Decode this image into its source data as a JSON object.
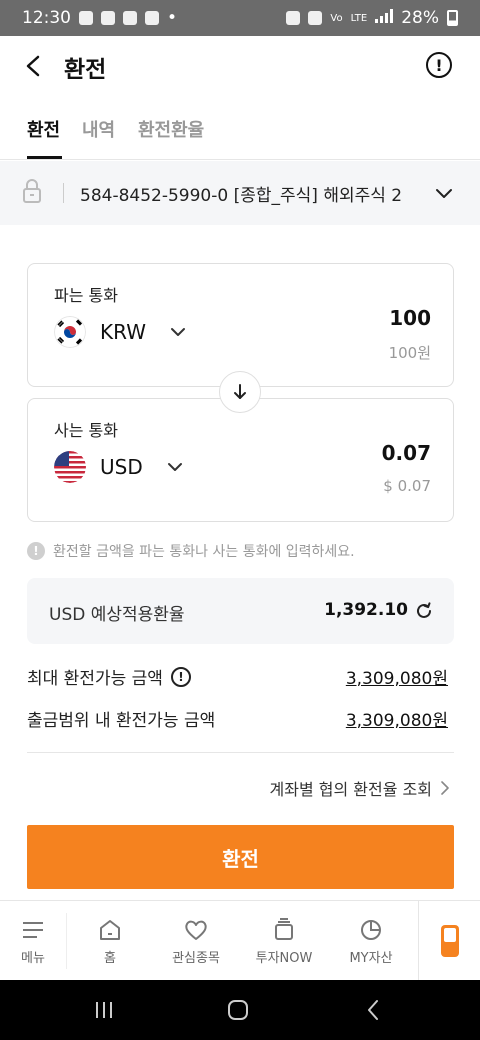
{
  "status_bar": {
    "time": "12:30",
    "network": "LTE",
    "battery": "28%"
  },
  "header": {
    "title": "환전"
  },
  "tabs": [
    {
      "label": "환전",
      "active": true
    },
    {
      "label": "내역",
      "active": false
    },
    {
      "label": "환전환율",
      "active": false
    }
  ],
  "account": {
    "text": "584-8452-5990-0  [종합_주식] 해외주식 2"
  },
  "sell": {
    "label": "파는 통화",
    "currency": "KRW",
    "amount": "100",
    "amount_sub": "100원"
  },
  "buy": {
    "label": "사는 통화",
    "currency": "USD",
    "amount": "0.07",
    "amount_sub": "$ 0.07"
  },
  "hint": "환전할 금액을 파는 통화나 사는 통화에 입력하세요.",
  "rate": {
    "label": "USD 예상적용환율",
    "value": "1,392.10"
  },
  "limits": [
    {
      "label": "최대 환전가능 금액",
      "value": "3,309,080원"
    },
    {
      "label": "출금범위 내 환전가능 금액",
      "value": "3,309,080원"
    }
  ],
  "rate_link": "계좌별 협의 환전율 조회",
  "cta": "환전",
  "bottom_nav": [
    {
      "label": "메뉴",
      "icon": "menu-icon"
    },
    {
      "label": "홈",
      "icon": "home-icon"
    },
    {
      "label": "관심종목",
      "icon": "heart-icon"
    },
    {
      "label": "투자NOW",
      "icon": "layers-icon"
    },
    {
      "label": "MY자산",
      "icon": "pie-chart-icon"
    }
  ],
  "colors": {
    "accent": "#f5821f",
    "text": "#222222",
    "muted": "#999999"
  }
}
